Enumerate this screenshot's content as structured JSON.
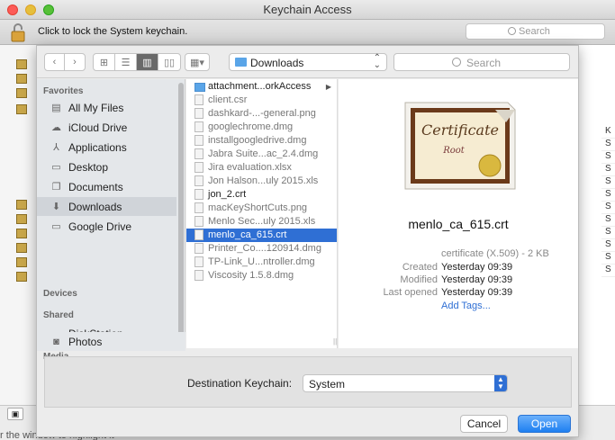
{
  "keychain": {
    "title": "Keychain Access",
    "lock_label": "Click to lock the System keychain.",
    "search_placeholder": "Search",
    "bottom_hint": "r the window to highlight it",
    "right_col_header": "K",
    "right_col_values": [
      "S",
      "S",
      "S",
      "S",
      "S",
      "S",
      "S",
      "S",
      "S",
      "S",
      "S"
    ]
  },
  "dialog": {
    "location": "Downloads",
    "search_placeholder": "Search",
    "sidebar": {
      "favorites_heading": "Favorites",
      "favorites": [
        {
          "label": "All My Files",
          "icon": "all-files-icon"
        },
        {
          "label": "iCloud Drive",
          "icon": "cloud-icon"
        },
        {
          "label": "Applications",
          "icon": "applications-icon"
        },
        {
          "label": "Desktop",
          "icon": "desktop-icon"
        },
        {
          "label": "Documents",
          "icon": "documents-icon"
        },
        {
          "label": "Downloads",
          "icon": "downloads-icon",
          "selected": true
        },
        {
          "label": "Google Drive",
          "icon": "folder-icon"
        }
      ],
      "devices_heading": "Devices",
      "shared_heading": "Shared",
      "shared": [
        {
          "label": "DiskStation",
          "icon": "server-icon"
        }
      ],
      "media_heading": "Media",
      "media": [
        {
          "label": "Photos",
          "icon": "camera-icon"
        }
      ]
    },
    "files": [
      {
        "name": "attachment...orkAccess",
        "folder": true
      },
      {
        "name": "client.csr"
      },
      {
        "name": "dashkard-...-general.png"
      },
      {
        "name": "googlechrome.dmg"
      },
      {
        "name": "installgoogledrive.dmg"
      },
      {
        "name": "Jabra Suite...ac_2.4.dmg"
      },
      {
        "name": "Jira evaluation.xlsx"
      },
      {
        "name": "Jon Halson...uly 2015.xls"
      },
      {
        "name": "jon_2.crt",
        "enabled": true
      },
      {
        "name": "macKeyShortCuts.png"
      },
      {
        "name": "Menlo Sec...uly 2015.xls"
      },
      {
        "name": "menlo_ca_615.crt",
        "selected": true
      },
      {
        "name": "Printer_Co....120914.dmg"
      },
      {
        "name": "TP-Link_U...ntroller.dmg"
      },
      {
        "name": "Viscosity 1.5.8.dmg"
      }
    ],
    "preview": {
      "cert_title": "Certificate",
      "cert_sub": "Root",
      "name": "menlo_ca_615.crt",
      "kind": "certificate (X.509) - 2 KB",
      "created_label": "Created",
      "created": "Yesterday 09:39",
      "modified_label": "Modified",
      "modified": "Yesterday 09:39",
      "last_opened_label": "Last opened",
      "last_opened": "Yesterday 09:39",
      "add_tags": "Add Tags..."
    },
    "destination_label": "Destination Keychain:",
    "destination_value": "System",
    "cancel": "Cancel",
    "open": "Open"
  }
}
